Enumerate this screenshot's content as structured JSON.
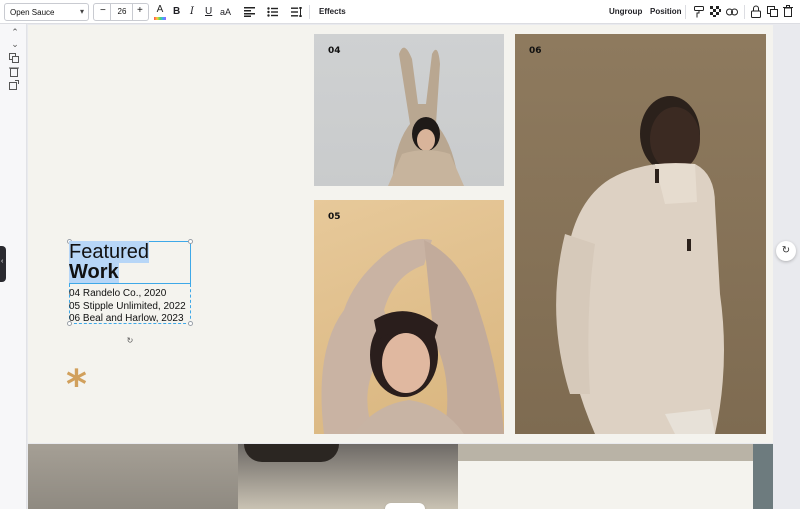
{
  "toolbar": {
    "font_family": "Open Sauce",
    "font_size": "26",
    "minus": "−",
    "plus": "+",
    "bold": "B",
    "italic": "I",
    "underline": "U",
    "case": "aA",
    "text_color": "A",
    "effects_label": "Effects",
    "ungroup_label": "Ungroup",
    "position_label": "Position"
  },
  "canvas": {
    "photos": [
      {
        "number": "04"
      },
      {
        "number": "05"
      },
      {
        "number": "06"
      }
    ],
    "title_line1": "Featured",
    "title_line2": "Work",
    "credits": [
      "04 Randelo Co., 2020",
      "05 Stipple Unlimited, 2022",
      "06 Beal and Harlow, 2023"
    ],
    "accent_color": "#d1a05c",
    "selection_color": "#3ea8e8"
  },
  "icons": {
    "asterisk": "*",
    "chevron_up": "⌃",
    "chevron_down": "⌄",
    "rotate": "↻",
    "fab": "↻"
  }
}
